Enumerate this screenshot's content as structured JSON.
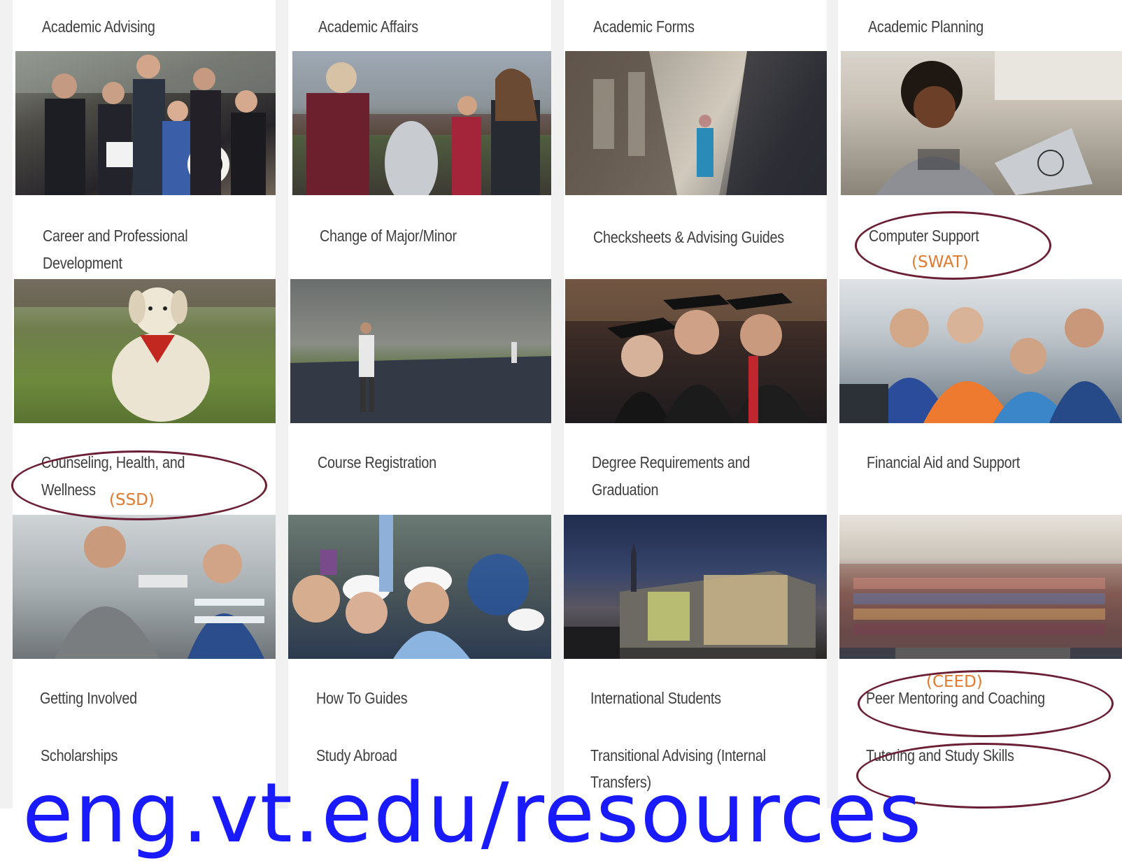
{
  "rows": [
    {
      "tiles": [
        {
          "label": "Academic Advising"
        },
        {
          "label": "Academic Affairs"
        },
        {
          "label": "Academic Forms"
        },
        {
          "label": "Academic Planning"
        }
      ]
    },
    {
      "tiles": [
        {
          "label_line1": "Career and Professional",
          "label_line2": "Development",
          "photo": "group-award-photo"
        },
        {
          "label_line1": "Change of Major/Minor",
          "photo": "outdoor-event-photo"
        },
        {
          "label_line1": "Checksheets & Advising Guides",
          "photo": "campus-walkway-photo"
        },
        {
          "label_line1": "Computer Support",
          "photo": "student-laptop-photo"
        }
      ]
    },
    {
      "tiles": [
        {
          "label_line1": "Counseling, Health, and",
          "label_line2": "Wellness",
          "photo": "therapy-dog-photo"
        },
        {
          "label_line1": "Course Registration",
          "photo": "drill-field-photo"
        },
        {
          "label_line1": "Degree Requirements and",
          "label_line2": "Graduation",
          "photo": "graduation-photo"
        },
        {
          "label_line1": "Financial Aid and Support",
          "photo": "lab-students-photo"
        }
      ]
    },
    {
      "tiles": [
        {
          "label": "Getting Involved",
          "photo": "robot-arm-photo"
        },
        {
          "label": "How To Guides",
          "photo": "hardhat-students-photo"
        },
        {
          "label": "International Students",
          "photo": "lumenhaus-night-photo"
        },
        {
          "label": "Peer Mentoring and Coaching",
          "photo": "group-selfie-photo"
        }
      ]
    },
    {
      "tiles": [
        {
          "label": "Scholarships"
        },
        {
          "label": "Study Abroad"
        },
        {
          "label_line1": "Transitional Advising (Internal",
          "label_line2": "Transfers)"
        },
        {
          "label": "Tutoring and Study Skills"
        }
      ]
    }
  ],
  "annotations": {
    "swat": "(SWAT)",
    "ssd": "(SSD)",
    "ceed": "(CEED)",
    "url_text": "eng.vt.edu/resources",
    "oval_color": "#6b1f35",
    "note_color": "#e07a2e",
    "url_color": "#1a1aff"
  }
}
